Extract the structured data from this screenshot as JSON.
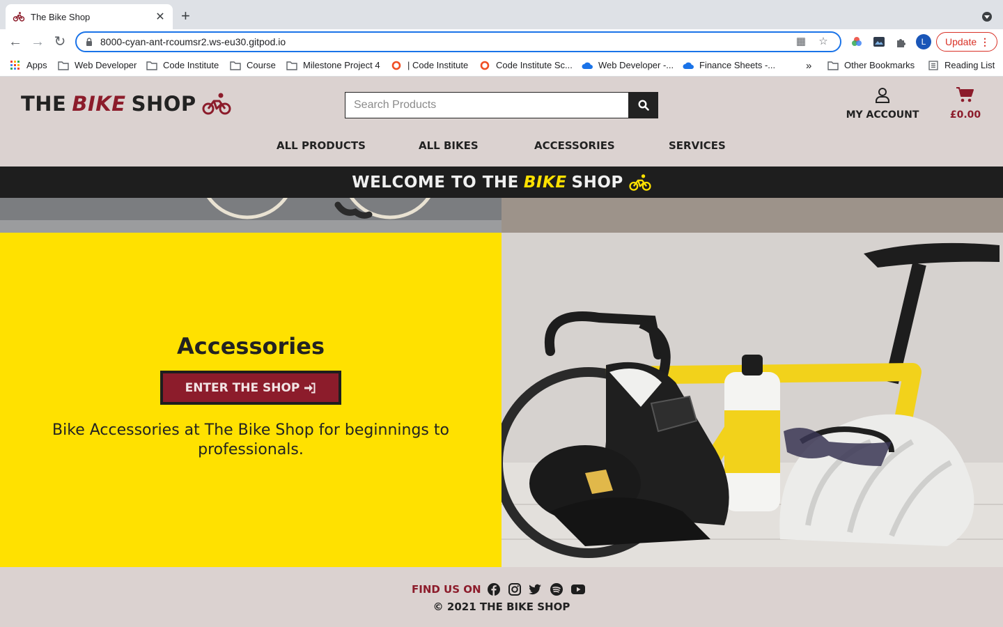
{
  "browser": {
    "tab_title": "The Bike Shop",
    "url": "8000-cyan-ant-rcoumsr2.ws-eu30.gitpod.io",
    "profile_initial": "L",
    "update_label": "Update",
    "bookmarks": [
      {
        "label": "Apps",
        "icon": "apps-grid-icon"
      },
      {
        "label": "Web Developer",
        "icon": "folder-icon"
      },
      {
        "label": "Code Institute",
        "icon": "folder-icon"
      },
      {
        "label": "Course",
        "icon": "folder-icon"
      },
      {
        "label": "Milestone Project 4",
        "icon": "folder-icon"
      },
      {
        "label": "| Code Institute",
        "icon": "ring-icon"
      },
      {
        "label": "Code Institute Sc...",
        "icon": "ring-icon"
      },
      {
        "label": "Web Developer -...",
        "icon": "cloud-icon"
      },
      {
        "label": "Finance Sheets -...",
        "icon": "cloud-icon"
      },
      {
        "label": "Other Bookmarks",
        "icon": "folder-icon"
      },
      {
        "label": "Reading List",
        "icon": "reading-list-icon"
      }
    ],
    "overflow_label": "»"
  },
  "header": {
    "logo": {
      "part1": "THE",
      "part2": "BIKE",
      "part3": "SHOP"
    },
    "search_placeholder": "Search Products",
    "account_label": "MY ACCOUNT",
    "cart_total": "£0.00"
  },
  "nav": [
    "ALL PRODUCTS",
    "ALL BIKES",
    "ACCESSORIES",
    "SERVICES"
  ],
  "welcome": {
    "part1": "WELCOME TO THE",
    "part2": "BIKE",
    "part3": "SHOP"
  },
  "accessories": {
    "title": "Accessories",
    "button_label": "ENTER THE SHOP",
    "description": "Bike Accessories at The Bike Shop for beginnings to professionals."
  },
  "footer": {
    "find_us": "FIND US ON",
    "socials": [
      "facebook-icon",
      "instagram-icon",
      "twitter-icon",
      "spotify-icon",
      "youtube-icon"
    ],
    "copyright": "© 2021 THE BIKE SHOP"
  },
  "colors": {
    "brand_red": "#8c1c2b",
    "brand_yellow": "#ffe100",
    "header_bg": "#dbd2d0",
    "dark": "#1e1e1e"
  }
}
